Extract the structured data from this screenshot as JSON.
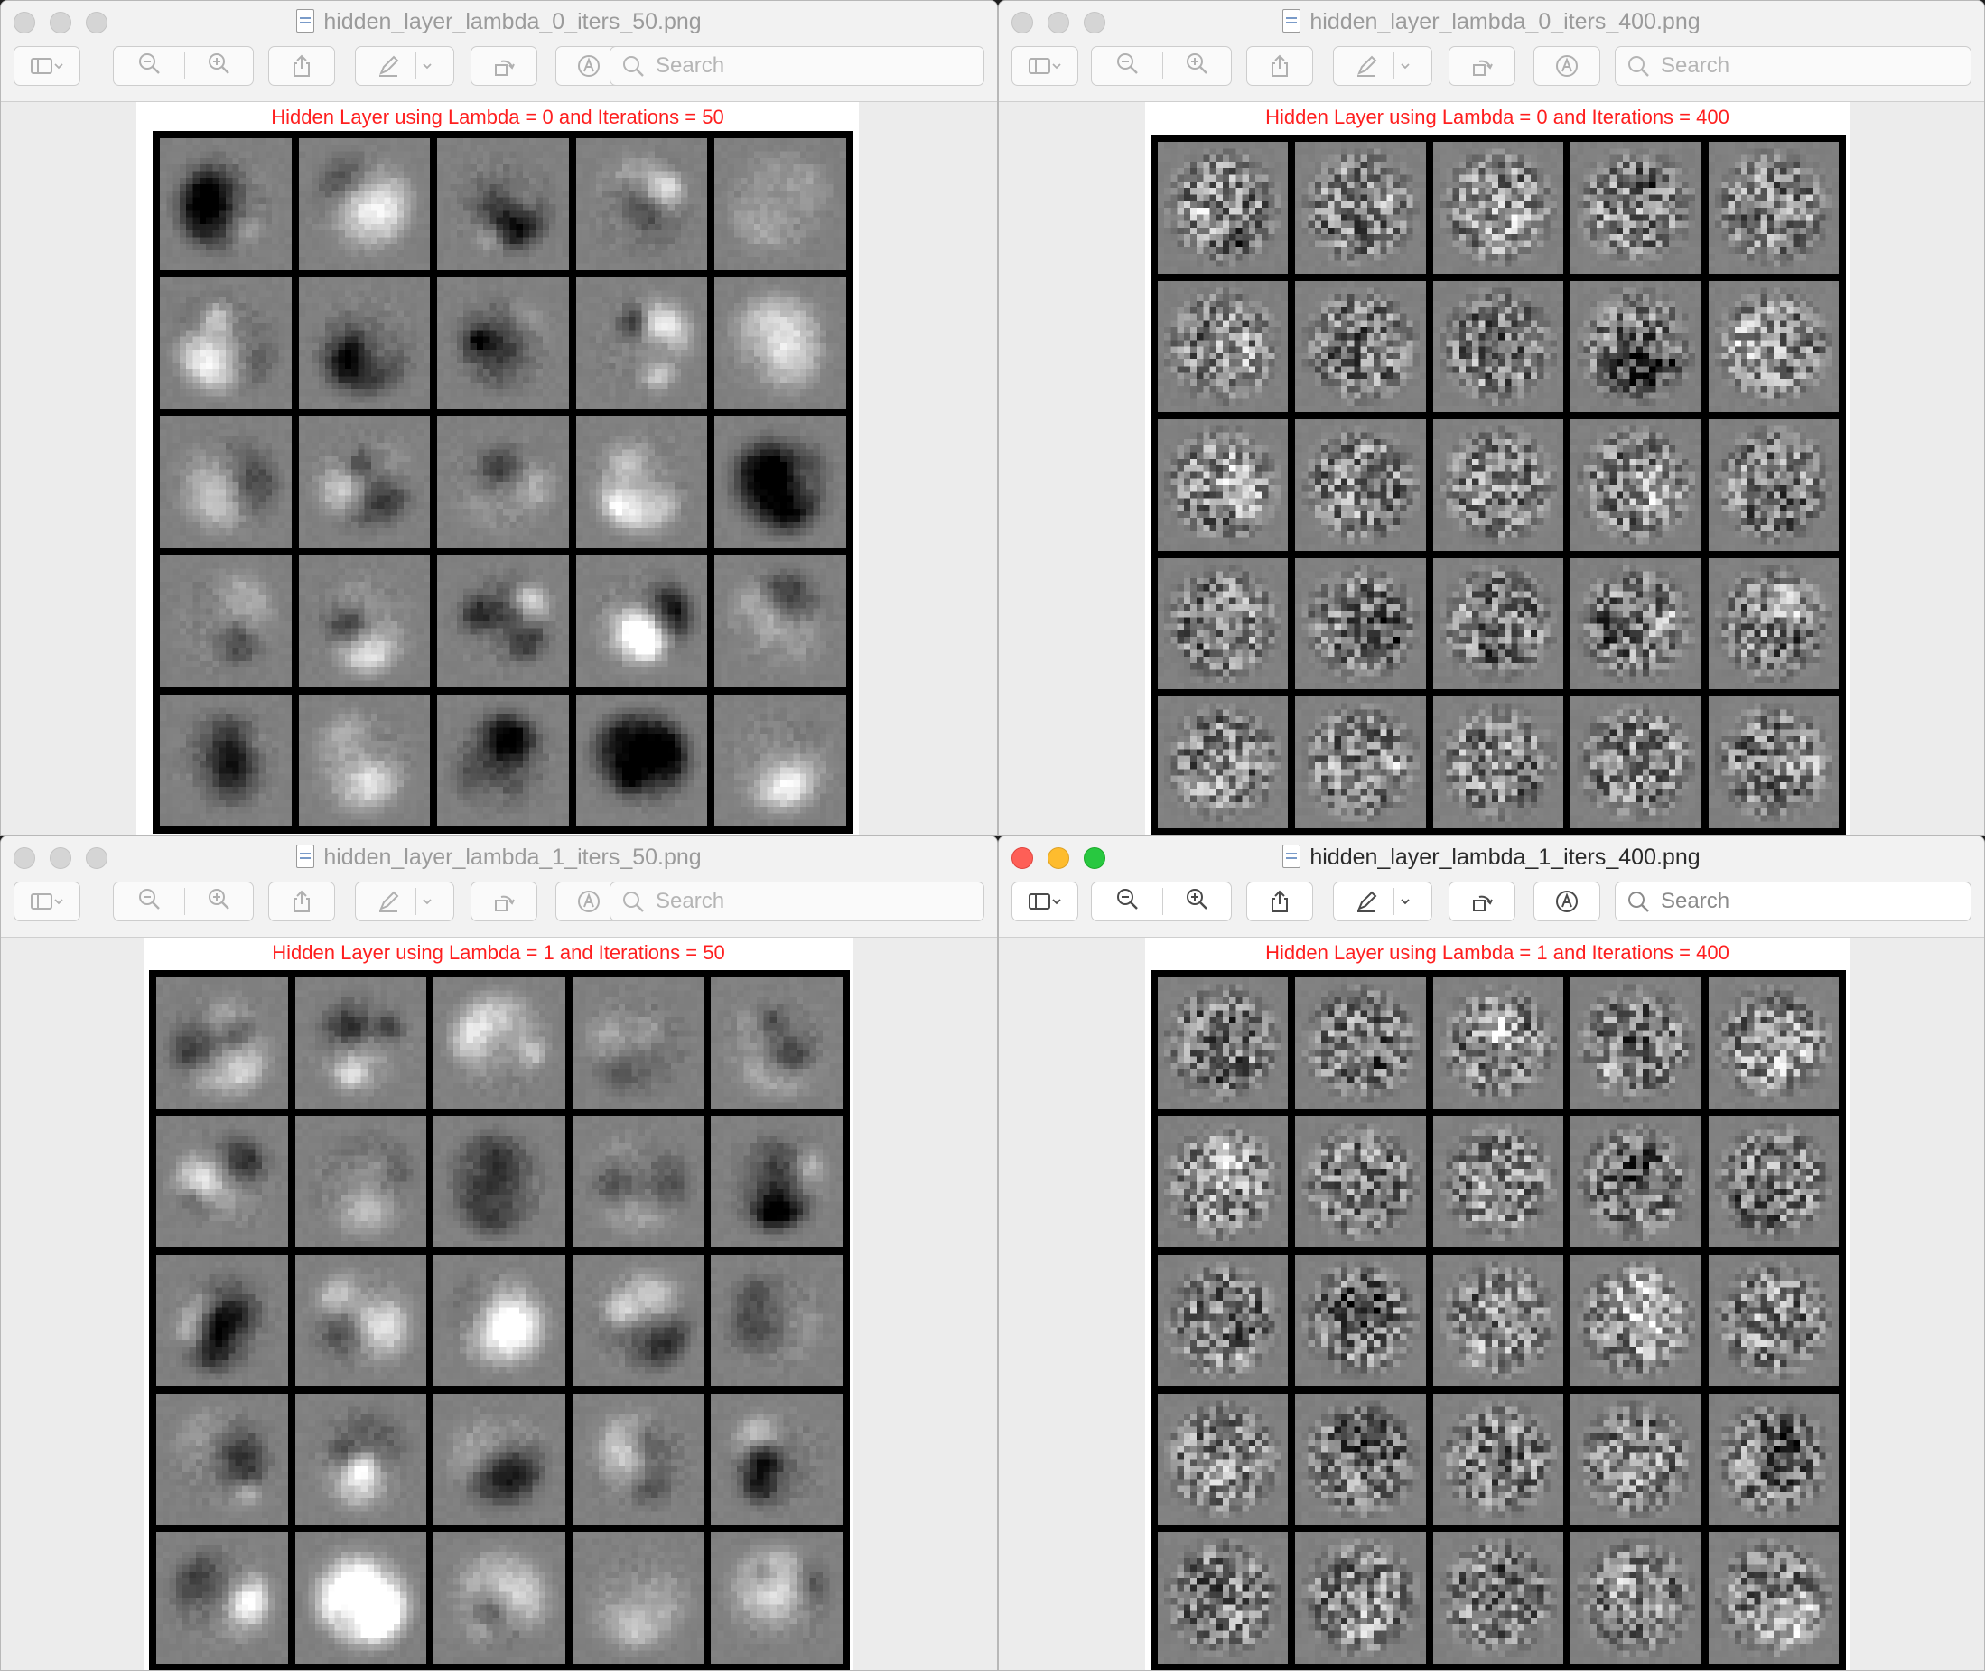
{
  "windows": [
    {
      "id": "w1",
      "title": "hidden_layer_lambda_0_iters_50.png",
      "plot_title": "Hidden Layer using Lambda = 0 and Iterations = 50",
      "search_placeholder": "Search",
      "active": false,
      "style": "smooth"
    },
    {
      "id": "w2",
      "title": "hidden_layer_lambda_0_iters_400.png",
      "plot_title": "Hidden Layer using Lambda = 0 and Iterations = 400",
      "search_placeholder": "Search",
      "active": false,
      "style": "noisy"
    },
    {
      "id": "w3",
      "title": "hidden_layer_lambda_1_iters_50.png",
      "plot_title": "Hidden Layer using Lambda = 1 and Iterations = 50",
      "search_placeholder": "Search",
      "active": false,
      "style": "smooth"
    },
    {
      "id": "w4",
      "title": "hidden_layer_lambda_1_iters_400.png",
      "plot_title": "Hidden Layer using Lambda = 1 and Iterations = 400",
      "search_placeholder": "Search",
      "active": true,
      "style": "noisy"
    }
  ],
  "toolbar_icons": [
    "sidebar-icon",
    "zoom-out-icon",
    "zoom-in-icon",
    "share-icon",
    "markup-pen-icon",
    "rotate-icon",
    "annotate-icon",
    "search-icon"
  ],
  "grid": {
    "rows": 5,
    "cols": 5
  }
}
